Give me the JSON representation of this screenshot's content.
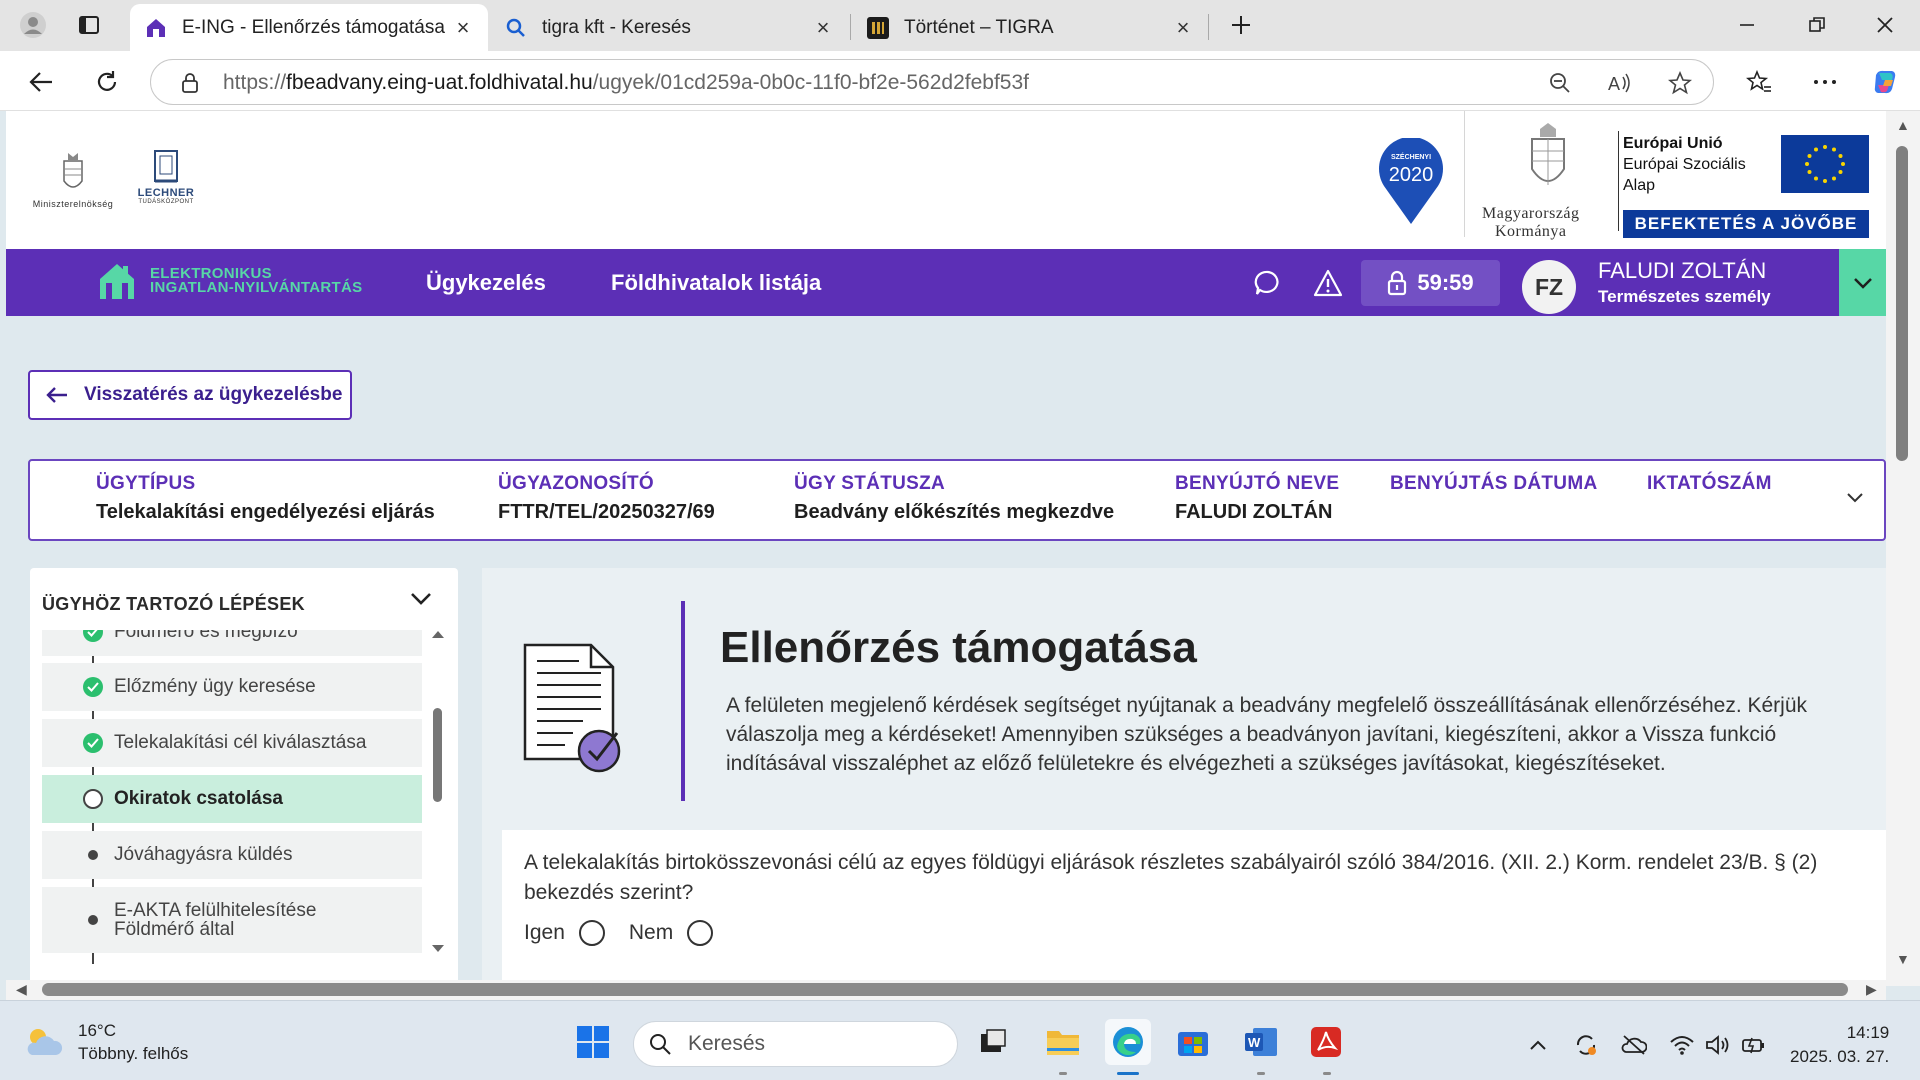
{
  "browser": {
    "tabs": [
      {
        "label": "E-ING - Ellenőrzés támogatása",
        "icon": "house-icon",
        "active": true
      },
      {
        "label": "tigra kft - Keresés",
        "icon": "search-icon",
        "active": false
      },
      {
        "label": "Történet – TIGRA",
        "icon": "tigra-icon",
        "active": false
      }
    ],
    "url_prefix": "https://",
    "url_host": "fbeadvany.eing-uat.foldhivatal.hu",
    "url_path": "/ugyek/01cd259a-0b0c-11f0-bf2e-562d2febf53f"
  },
  "logos": {
    "ministry": "Miniszterelnökség",
    "lechner": "LECHNER",
    "lechner_sub": "TUDÁSKÖZPONT",
    "szechenyi_top": "SZÉCHENYI",
    "szechenyi_year": "2020",
    "gov_line1": "Magyarország",
    "gov_line2": "Kormánya",
    "eu_line1": "Európai Unió",
    "eu_line2": "Európai Szociális",
    "eu_line3": "Alap",
    "eu_banner": "BEFEKTETÉS A JÖVŐBE"
  },
  "header": {
    "brand_line1": "ELEKTRONIKUS",
    "brand_line2": "INGATLAN-NYILVÁNTARTÁS",
    "menu": [
      "Ügykezelés",
      "Földhivatalok listája"
    ],
    "timer": "59:59",
    "avatar_initials": "FZ",
    "user_name": "FALUDI ZOLTÁN",
    "user_role": "Természetes személy",
    "colors": {
      "primary": "#5c2fb6",
      "accent": "#57d7a6"
    }
  },
  "back_button": "Visszatérés az ügykezelésbe",
  "info": [
    {
      "head": "ÜGYTÍPUS",
      "value": "Telekalakítási engedélyezési eljárás"
    },
    {
      "head": "ÜGYAZONOSÍTÓ",
      "value": "FTTR/TEL/20250327/69"
    },
    {
      "head": "ÜGY STÁTUSZA",
      "value": "Beadvány előkészítés megkezdve"
    },
    {
      "head": "BENYÚJTÓ NEVE",
      "value": "FALUDI ZOLTÁN"
    },
    {
      "head": "BENYÚJTÁS DÁTUMA",
      "value": ""
    },
    {
      "head": "IKTATÓSZÁM",
      "value": ""
    }
  ],
  "steps": {
    "title": "ÜGYHÖZ TARTOZÓ LÉPÉSEK",
    "items": [
      {
        "label": "Földmérő és megbízó",
        "state": "done"
      },
      {
        "label": "Előzmény ügy keresése",
        "state": "done"
      },
      {
        "label": "Telekalakítási cél kiválasztása",
        "state": "done"
      },
      {
        "label": "Okiratok csatolása",
        "state": "current"
      },
      {
        "label": "Jóváhagyásra küldés",
        "state": "pending"
      },
      {
        "label": "E-AKTA felülhitelesítése Földmérő által",
        "state": "pending"
      }
    ]
  },
  "main": {
    "title": "Ellenőrzés támogatása",
    "description": "A felületen megjelenő kérdések segítséget nyújtanak a beadvány megfelelő összeállításának ellenőrzéséhez. Kérjük válaszolja meg a kérdéseket! Amennyiben szükséges a beadványon javítani, kiegészíteni, akkor a Vissza funkció indításával visszaléphet az előző felületekre és elvégezheti a szükséges javításokat, kiegészítéseket.",
    "question": "A telekalakítás birtokösszevonási célú az egyes földügyi eljárások részletes szabályairól szóló 384/2016. (XII. 2.) Korm. rendelet 23/B. § (2) bekezdés szerint?",
    "options": [
      "Igen",
      "Nem"
    ]
  },
  "taskbar": {
    "weather_temp": "16°C",
    "weather_desc": "Többny. felhős",
    "search_placeholder": "Keresés",
    "time": "14:19",
    "date": "2025. 03. 27."
  }
}
